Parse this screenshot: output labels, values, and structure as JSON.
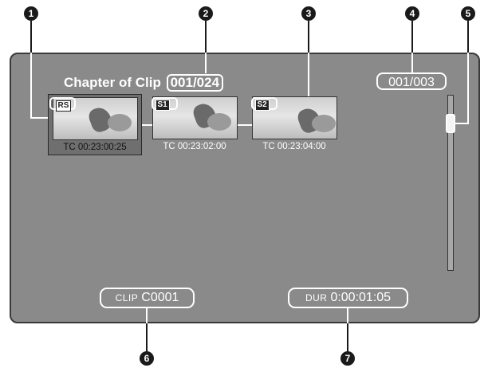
{
  "header": {
    "title": "Chapter of Clip",
    "clip_count": "001/024"
  },
  "page_counter": "001/003",
  "thumbnails": [
    {
      "tag": "RS",
      "timecode": "TC 00:23:00:25",
      "selected": true
    },
    {
      "tag": "S1",
      "timecode": "TC 00:23:02:00",
      "selected": false
    },
    {
      "tag": "S2",
      "timecode": "TC 00:23:04:00",
      "selected": false
    }
  ],
  "footer": {
    "clip_label": "CLIP",
    "clip_value": "C0001",
    "dur_label": "DUR",
    "dur_value": "0:00:01:05"
  },
  "scroll_position": 0.1,
  "callouts": [
    "1",
    "2",
    "3",
    "4",
    "5",
    "6",
    "7"
  ]
}
